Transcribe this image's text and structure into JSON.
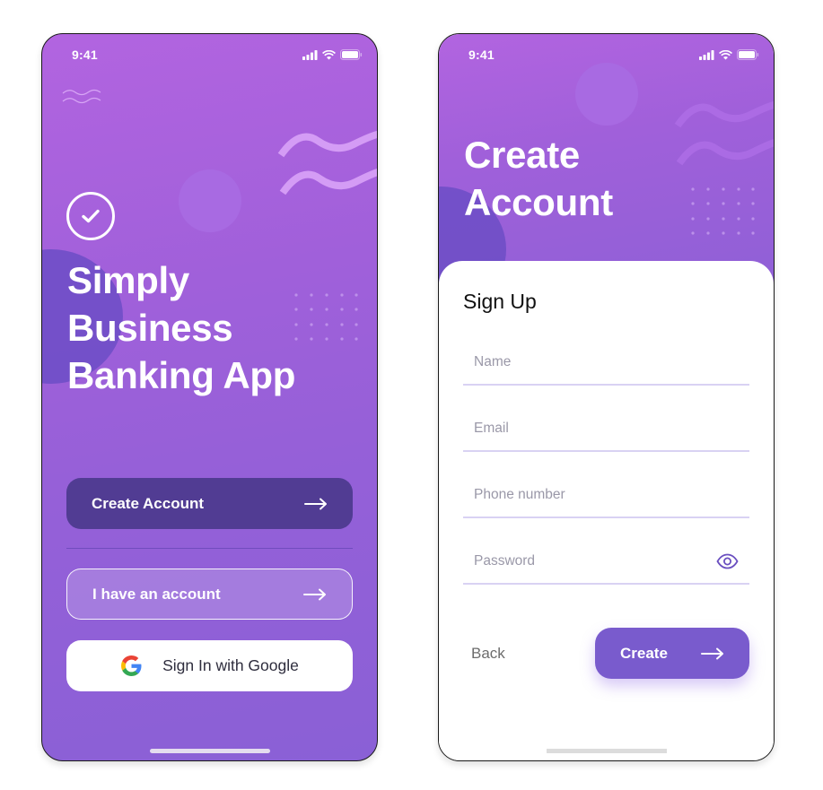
{
  "screens": {
    "welcome": {
      "status_time": "9:41",
      "title_lines": [
        "Simply",
        "Business",
        "Banking App"
      ],
      "buttons": {
        "create_account": "Create Account",
        "have_account": "I have an account",
        "google_sign_in": "Sign In with Google"
      }
    },
    "signup": {
      "status_time": "9:41",
      "title_lines": [
        "Create",
        "Account"
      ],
      "subtitle": "Sign Up",
      "fields": {
        "name": {
          "placeholder": "Name",
          "value": ""
        },
        "email": {
          "placeholder": "Email",
          "value": ""
        },
        "phone": {
          "placeholder": "Phone number",
          "value": ""
        },
        "password": {
          "placeholder": "Password",
          "value": ""
        }
      },
      "buttons": {
        "back": "Back",
        "create": "Create"
      }
    }
  },
  "icons": {
    "check": "check-circle-icon",
    "arrow": "arrow-right-icon",
    "google": "google-g-icon",
    "eye": "eye-icon",
    "signal": "signal-icon",
    "wifi": "wifi-icon",
    "battery": "battery-icon"
  },
  "colors": {
    "gradient_top": "#b264e0",
    "gradient_bottom": "#8a60d6",
    "primary_dark": "#513c93",
    "primary": "#795bcd",
    "field_underline": "#d9d2f3",
    "eye_icon": "#6a4fc0"
  }
}
